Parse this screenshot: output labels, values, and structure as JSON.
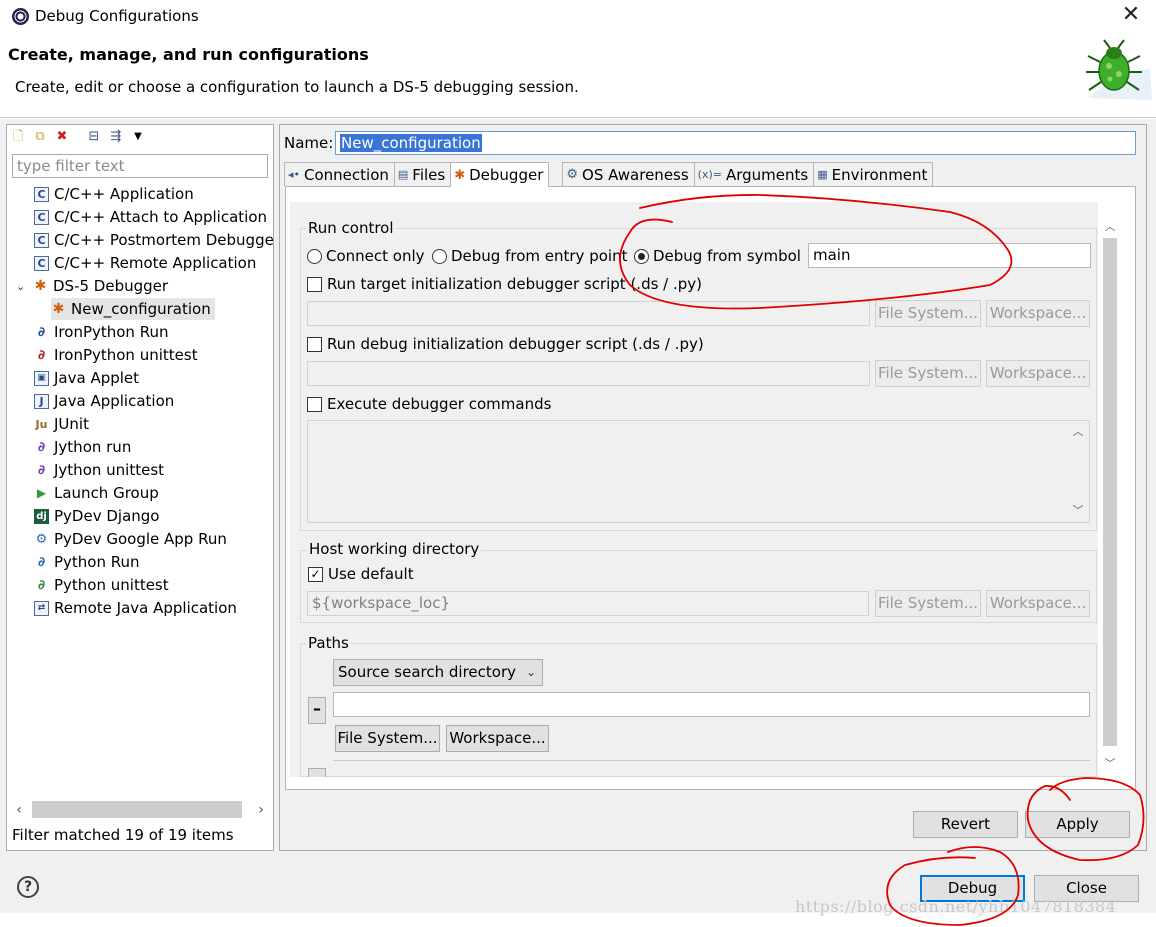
{
  "window": {
    "title": "Debug Configurations",
    "close_glyph": "✕"
  },
  "header": {
    "title": "Create, manage, and run configurations",
    "subtitle": "Create, edit or choose a configuration to launch a DS-5 debugging session."
  },
  "left": {
    "filter_placeholder": "type filter text",
    "tree": [
      {
        "label": "C/C++ Application",
        "icon": "c-icon"
      },
      {
        "label": "C/C++ Attach to Application",
        "icon": "c-icon"
      },
      {
        "label": "C/C++ Postmortem Debugge",
        "icon": "c-icon"
      },
      {
        "label": "C/C++ Remote Application",
        "icon": "c-icon"
      },
      {
        "label": "DS-5 Debugger",
        "icon": "ds5-icon"
      },
      {
        "label": "New_configuration",
        "icon": "ds5-icon"
      },
      {
        "label": "IronPython Run",
        "icon": "python-icon"
      },
      {
        "label": "IronPython unittest",
        "icon": "python-unittest-icon"
      },
      {
        "label": "Java Applet",
        "icon": "java-applet-icon"
      },
      {
        "label": "Java Application",
        "icon": "java-app-icon"
      },
      {
        "label": "JUnit",
        "icon": "junit-icon"
      },
      {
        "label": "Jython run",
        "icon": "python-icon"
      },
      {
        "label": "Jython unittest",
        "icon": "python-unittest-icon"
      },
      {
        "label": "Launch Group",
        "icon": "launch-group-icon"
      },
      {
        "label": "PyDev Django",
        "icon": "django-icon"
      },
      {
        "label": "PyDev Google App Run",
        "icon": "google-app-icon"
      },
      {
        "label": "Python Run",
        "icon": "python-icon"
      },
      {
        "label": "Python unittest",
        "icon": "python-unittest-icon"
      },
      {
        "label": "Remote Java Application",
        "icon": "remote-java-icon"
      }
    ],
    "status": "Filter matched 19 of 19 items"
  },
  "right": {
    "name_label": "Name:",
    "name_value": "New_configuration",
    "tabs": [
      {
        "label": "Connection",
        "icon": "connection-icon"
      },
      {
        "label": "Files",
        "icon": "files-icon"
      },
      {
        "label": "Debugger",
        "icon": "debugger-icon",
        "active": true
      },
      {
        "label": "OS Awareness",
        "icon": "os-awareness-icon"
      },
      {
        "label": "Arguments",
        "icon": "arguments-icon"
      },
      {
        "label": "Environment",
        "icon": "environment-icon"
      }
    ],
    "run_control": {
      "label": "Run control",
      "radio_connect": "Connect only",
      "radio_entry": "Debug from entry point",
      "radio_symbol": "Debug from symbol",
      "symbol_value": "main",
      "check_target_script": "Run target initialization debugger script (.ds / .py)",
      "check_debug_script": "Run debug initialization debugger script (.ds / .py)",
      "check_exec_commands": "Execute debugger commands",
      "file_system": "File System...",
      "workspace": "Workspace..."
    },
    "host_dir": {
      "label": "Host working directory",
      "use_default": "Use default",
      "value": "${workspace_loc}",
      "file_system": "File System...",
      "workspace": "Workspace..."
    },
    "paths": {
      "label": "Paths",
      "select_value": "Source search directory",
      "minus": "–",
      "file_system": "File System...",
      "workspace": "Workspace..."
    },
    "revert": "Revert",
    "apply": "Apply"
  },
  "footer": {
    "help": "?",
    "debug": "Debug",
    "close": "Close"
  },
  "watermark": "https://blog.csdn.net/yhb1047818384",
  "colors": {
    "selection": "#3875d7",
    "annotation": "#e00000",
    "default_button_border": "#0078d7"
  }
}
